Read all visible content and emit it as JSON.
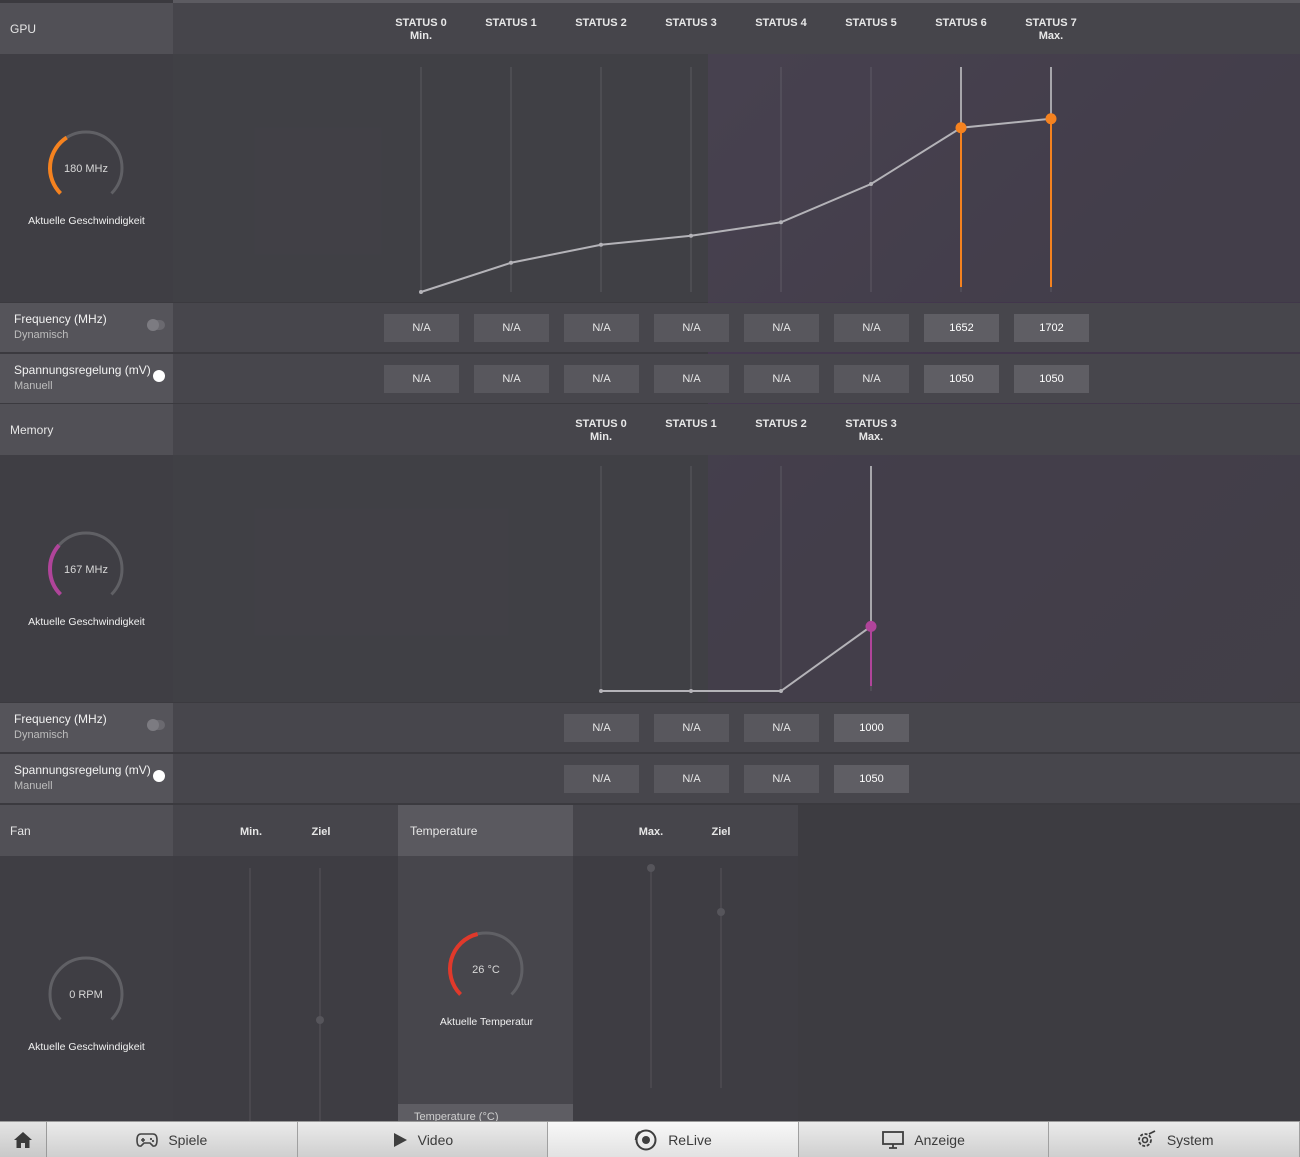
{
  "gpu": {
    "title": "GPU",
    "states": [
      {
        "name": "STATUS 0",
        "sub": "Min."
      },
      {
        "name": "STATUS 1",
        "sub": ""
      },
      {
        "name": "STATUS 2",
        "sub": ""
      },
      {
        "name": "STATUS 3",
        "sub": ""
      },
      {
        "name": "STATUS 4",
        "sub": ""
      },
      {
        "name": "STATUS 5",
        "sub": ""
      },
      {
        "name": "STATUS 6",
        "sub": ""
      },
      {
        "name": "STATUS 7",
        "sub": "Max."
      }
    ],
    "gauge_value": "180 MHz",
    "gauge_fraction": 0.38,
    "gauge_label": "Aktuelle Geschwindigkeit",
    "frequency": {
      "title": "Frequency (MHz)",
      "mode": "Dynamisch",
      "toggle_on": false,
      "values": [
        "N/A",
        "N/A",
        "N/A",
        "N/A",
        "N/A",
        "N/A",
        "1652",
        "1702"
      ]
    },
    "voltage": {
      "title": "Spannungsregelung (mV)",
      "mode": "Manuell",
      "toggle_on": true,
      "values": [
        "N/A",
        "N/A",
        "N/A",
        "N/A",
        "N/A",
        "N/A",
        "1050",
        "1050"
      ]
    },
    "curve_levels": [
      0.0,
      0.13,
      0.21,
      0.25,
      0.31,
      0.48,
      0.73,
      0.77
    ],
    "active_states": [
      6,
      7
    ]
  },
  "memory": {
    "title": "Memory",
    "states": [
      {
        "name": "STATUS 0",
        "sub": "Min."
      },
      {
        "name": "STATUS 1",
        "sub": ""
      },
      {
        "name": "STATUS 2",
        "sub": ""
      },
      {
        "name": "STATUS 3",
        "sub": "Max."
      }
    ],
    "gauge_value": "167 MHz",
    "gauge_fraction": 0.32,
    "gauge_label": "Aktuelle Geschwindigkeit",
    "frequency": {
      "title": "Frequency (MHz)",
      "mode": "Dynamisch",
      "toggle_on": false,
      "values": [
        "N/A",
        "N/A",
        "N/A",
        "1000"
      ]
    },
    "voltage": {
      "title": "Spannungsregelung (mV)",
      "mode": "Manuell",
      "toggle_on": true,
      "values": [
        "N/A",
        "N/A",
        "N/A",
        "1050"
      ]
    },
    "curve_levels": [
      0.0,
      0.0,
      0.0,
      0.29
    ],
    "active_states": [
      3
    ]
  },
  "fan": {
    "title": "Fan",
    "col_min": "Min.",
    "col_target": "Ziel",
    "gauge_value": "0 RPM",
    "gauge_fraction": 0.0,
    "gauge_label": "Aktuelle Geschwindigkeit"
  },
  "temperature": {
    "title": "Temperature",
    "col_max": "Max.",
    "col_target": "Ziel",
    "gauge_value": "26 °C",
    "gauge_fraction": 0.45,
    "gauge_label": "Aktuelle Temperatur",
    "sub_label": "Temperature (°C)"
  },
  "taskbar": {
    "items": [
      {
        "label": "Spiele",
        "icon": "gamepad-icon"
      },
      {
        "label": "Video",
        "icon": "play-icon"
      },
      {
        "label": "ReLive",
        "icon": "relive-icon"
      },
      {
        "label": "Anzeige",
        "icon": "monitor-icon"
      },
      {
        "label": "System",
        "icon": "gear-icon"
      }
    ],
    "active_index": 2
  },
  "colors": {
    "gpu_accent": "#f5821f",
    "memory_accent": "#b0449a",
    "temp_accent": "#e0392b",
    "gauge_track": "#606065"
  }
}
